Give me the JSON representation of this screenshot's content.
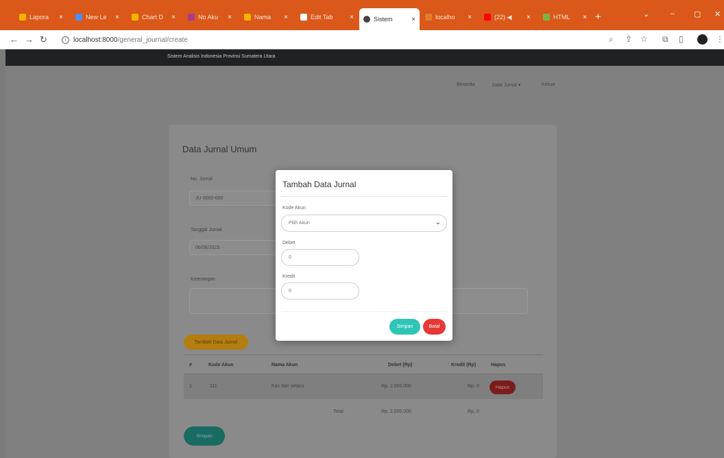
{
  "browser": {
    "tabs": [
      {
        "label": "Lapora",
        "fav": "#f4b400"
      },
      {
        "label": "New Le",
        "fav": "#4a8ef4"
      },
      {
        "label": "Chart D",
        "fav": "#f4b400"
      },
      {
        "label": "No Aku",
        "fav": "#a63c8c"
      },
      {
        "label": "Nama",
        "fav": "#f4b400"
      },
      {
        "label": "Edit Tab",
        "fav": "#ffffff"
      },
      {
        "label": "Sistem",
        "fav": "#444444"
      },
      {
        "label": "localho",
        "fav": "#e37e2c"
      },
      {
        "label": "(22) ◀",
        "fav": "#ff0000"
      },
      {
        "label": "HTML",
        "fav": "#7cb342"
      }
    ],
    "url_host": "localhost:8000",
    "url_path": "/general_journal/create"
  },
  "app": {
    "navbar_title": "Sistem Analisis Indonesia Provinsi Sumatera Utara",
    "menu": {
      "beranda": "Beranda",
      "data_jurnal": "Data Jurnal ▾",
      "keluar": "Keluar"
    }
  },
  "page": {
    "title": "Data Jurnal Umum",
    "no_jurnal_label": "No. Jurnal",
    "no_jurnal_value": "JU-0000-000",
    "tanggal_label": "Tanggal Jurnal",
    "tanggal_value": "06/06/2023",
    "keterangan_label": "Keterangan",
    "add_button": "Tambah Data Jurnal",
    "table": {
      "headers": [
        "#",
        "Kode Akun",
        "Nama Akun",
        "Debet (Rp)",
        "Kredit (Rp)",
        "Hapus"
      ],
      "row": {
        "no": "1",
        "kode": "111",
        "nama": "Kas dan setara",
        "debet": "Rp. 2.000.000",
        "kredit": "Rp. 0",
        "hapus": "Hapus"
      },
      "total_label": "Total",
      "total_debet": "Rp. 2.000.000",
      "total_kredit": "Rp. 0"
    },
    "save_button": "Simpan"
  },
  "modal": {
    "title": "Tambah Data Jurnal",
    "kode_akun_label": "Kode Akun",
    "kode_akun_value": "Pilih Akun",
    "debet_label": "Debet",
    "debet_value": "0",
    "kredit_label": "Kredit",
    "kredit_value": "0",
    "simpan": "Simpan",
    "batal": "Batal"
  }
}
